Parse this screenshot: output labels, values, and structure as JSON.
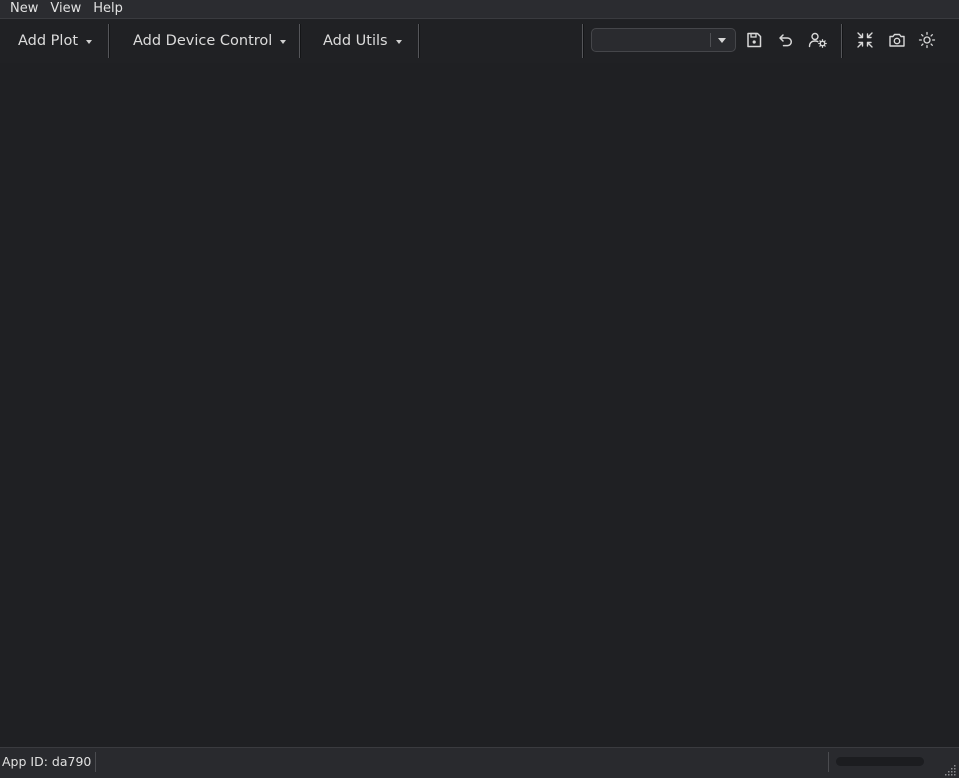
{
  "menubar": {
    "items": [
      {
        "label": "New"
      },
      {
        "label": "View"
      },
      {
        "label": "Help"
      }
    ]
  },
  "toolbar": {
    "add_plot_label": "Add Plot",
    "add_device_control_label": "Add Device Control",
    "add_utils_label": "Add Utils",
    "profile_combo": {
      "value": ""
    },
    "icons": {
      "save": "save-icon",
      "undo": "undo-icon",
      "user_settings": "user-settings-icon",
      "collapse": "collapse-icon",
      "screenshot": "camera-icon",
      "theme": "sun-icon"
    }
  },
  "statusbar": {
    "app_id_text": "App ID: da790",
    "progress": 0
  },
  "colors": {
    "background": "#1f2023",
    "menubar": "#2b2c30",
    "text": "#dcdcdc"
  }
}
